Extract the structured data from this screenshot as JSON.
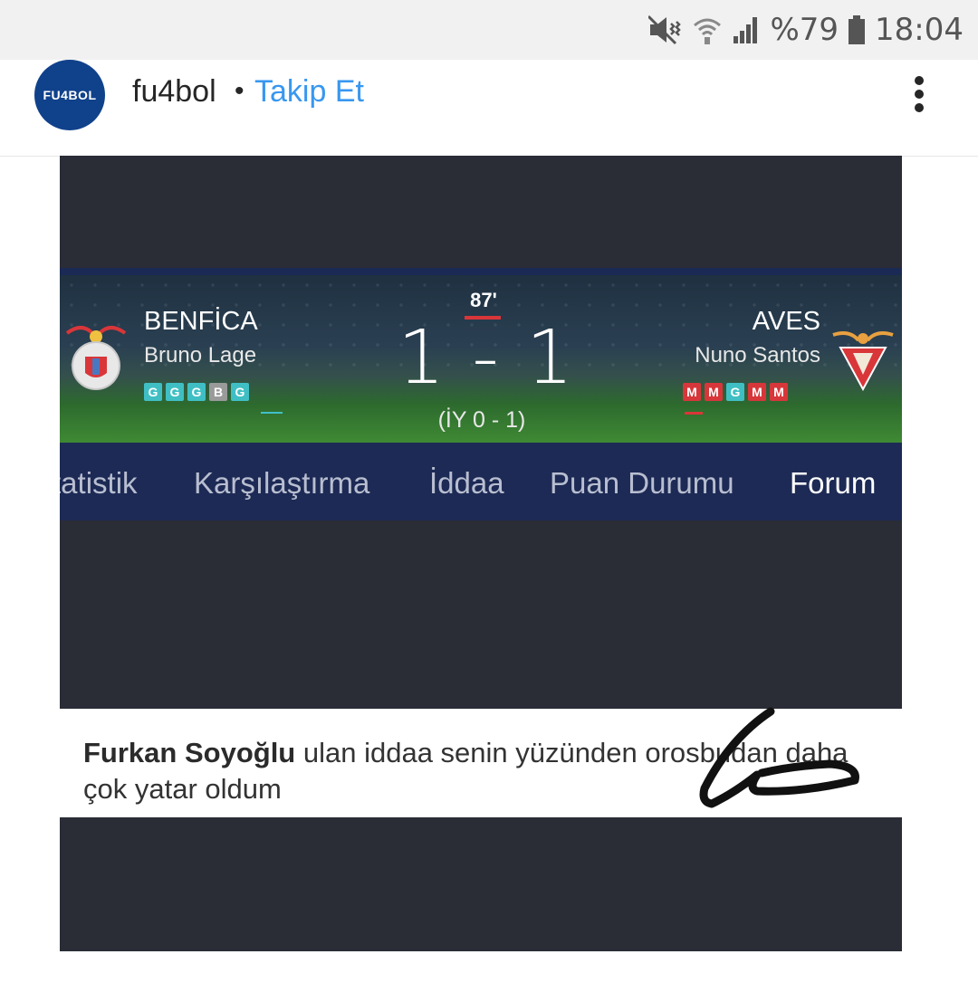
{
  "status_bar": {
    "battery": "%79",
    "time": "18:04",
    "icons": [
      "mute-vibrate-icon",
      "wifi-icon",
      "signal-icon",
      "battery-icon"
    ]
  },
  "post": {
    "avatar_text": "FU4BOL",
    "username": "fu4bol",
    "separator": "•",
    "follow_label": "Takip Et",
    "more_icon": "more-vertical-icon"
  },
  "match": {
    "minute": "87'",
    "score": "1 - 1",
    "halftime": "(İY 0 - 1)",
    "home": {
      "name": "BENFİCA",
      "coach": "Bruno Lage",
      "form": [
        "G",
        "G",
        "G",
        "B",
        "G"
      ]
    },
    "away": {
      "name": "AVES",
      "coach": "Nuno Santos",
      "form": [
        "M",
        "M",
        "G",
        "M",
        "M"
      ]
    },
    "tabs": [
      "tatistik",
      "Karşılaştırma",
      "İddaa",
      "Puan Durumu",
      "Forum"
    ],
    "active_tab": "Forum"
  },
  "comment": {
    "author": "Furkan Soyoğlu",
    "text": "ulan iddaa senin yüzünden orosbudan daha çok yatar oldum"
  },
  "colors": {
    "follow_blue": "#3897f0",
    "avatar_blue": "#10418b",
    "form_win": "#3fbfc4",
    "form_draw": "#9a9a9a",
    "form_loss": "#d7373a",
    "tab_bar": "#1d2a55"
  }
}
